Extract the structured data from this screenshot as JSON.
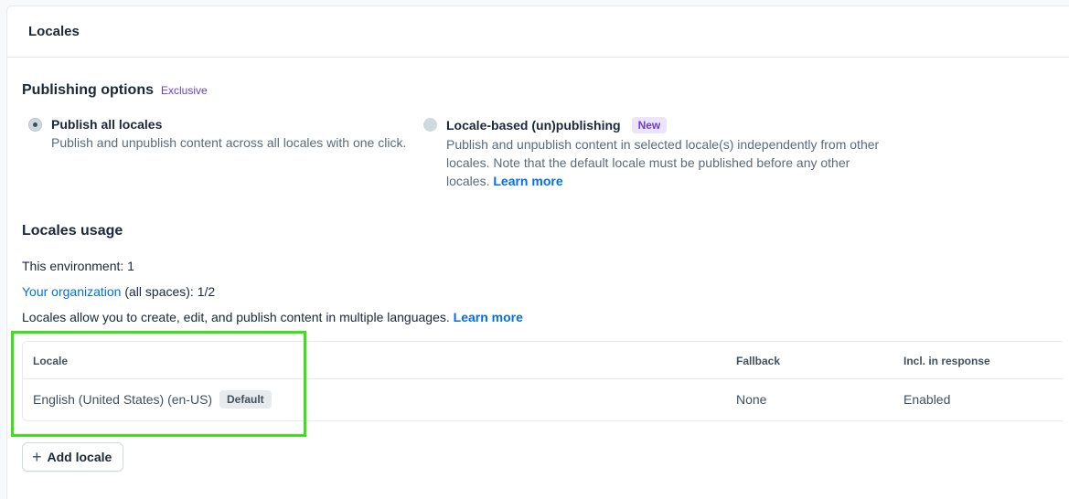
{
  "card": {
    "title": "Locales"
  },
  "publishing": {
    "heading": "Publishing options",
    "badge": "Exclusive",
    "options": [
      {
        "title": "Publish all locales",
        "desc": "Publish and unpublish content across all locales with one click.",
        "checked": true
      },
      {
        "title": "Locale-based (un)publishing",
        "badge": "New",
        "desc": "Publish and unpublish content in selected locale(s) independently from other locales. Note that the default locale must be published before any other locales.",
        "link": "Learn more",
        "checked": false
      }
    ]
  },
  "usage": {
    "heading": "Locales usage",
    "environment": "This environment: 1",
    "org_link": "Your organization",
    "org_rest": " (all spaces): 1/2",
    "info": "Locales allow you to create, edit, and publish content in multiple languages.",
    "info_link": "Learn more"
  },
  "table": {
    "headers": {
      "locale": "Locale",
      "fallback": "Fallback",
      "response": "Incl. in response"
    },
    "rows": [
      {
        "locale": "English (United States) (en-US)",
        "badge": "Default",
        "fallback": "None",
        "response": "Enabled"
      }
    ]
  },
  "add_button": {
    "label": "Add locale"
  },
  "colors": {
    "accent": "#036fe3",
    "highlight": "#3ee01a",
    "purple": "#6c3ecf"
  }
}
